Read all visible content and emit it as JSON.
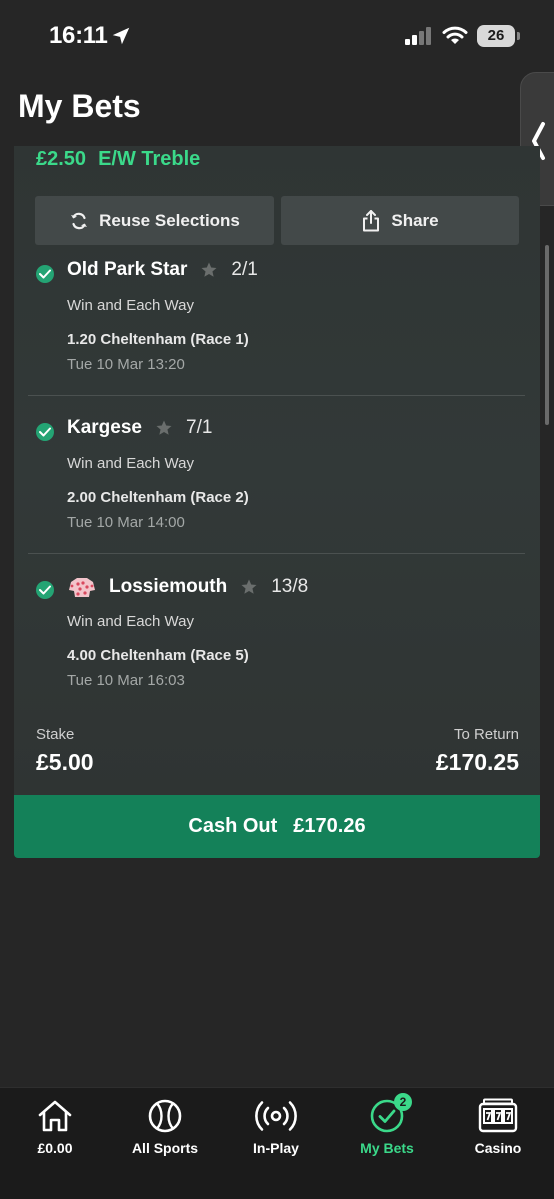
{
  "status_bar": {
    "time": "16:11",
    "battery": "26"
  },
  "page": {
    "title": "My Bets"
  },
  "bet": {
    "stake_amount": "£2.50",
    "bet_type": "E/W Treble",
    "reuse_label": "Reuse Selections",
    "share_label": "Share",
    "selections": [
      {
        "name": "Old Park Star",
        "odds": "2/1",
        "market": "Win and Each Way",
        "race": "1.20 Cheltenham (Race 1)",
        "datetime": "Tue 10 Mar 13:20"
      },
      {
        "name": "Kargese",
        "odds": "7/1",
        "market": "Win and Each Way",
        "race": "2.00 Cheltenham (Race 2)",
        "datetime": "Tue 10 Mar 14:00"
      },
      {
        "name": "Lossiemouth",
        "odds": "13/8",
        "market": "Win and Each Way",
        "race": "4.00 Cheltenham (Race 5)",
        "datetime": "Tue 10 Mar 16:03"
      }
    ],
    "stake_label": "Stake",
    "stake_value": "£5.00",
    "return_label": "To Return",
    "return_value": "£170.25",
    "cashout_label": "Cash Out",
    "cashout_value": "£170.26"
  },
  "nav": {
    "items": [
      {
        "label": "£0.00",
        "icon": "home-icon"
      },
      {
        "label": "All Sports",
        "icon": "tennis-ball-icon"
      },
      {
        "label": "In-Play",
        "icon": "broadcast-icon"
      },
      {
        "label": "My Bets",
        "icon": "check-circle-icon",
        "badge": "2"
      },
      {
        "label": "Casino",
        "icon": "slot-machine-icon"
      }
    ]
  },
  "colors": {
    "accent": "#3bd98a",
    "cashout": "#148159",
    "check": "#24a474",
    "background": "#262626"
  }
}
